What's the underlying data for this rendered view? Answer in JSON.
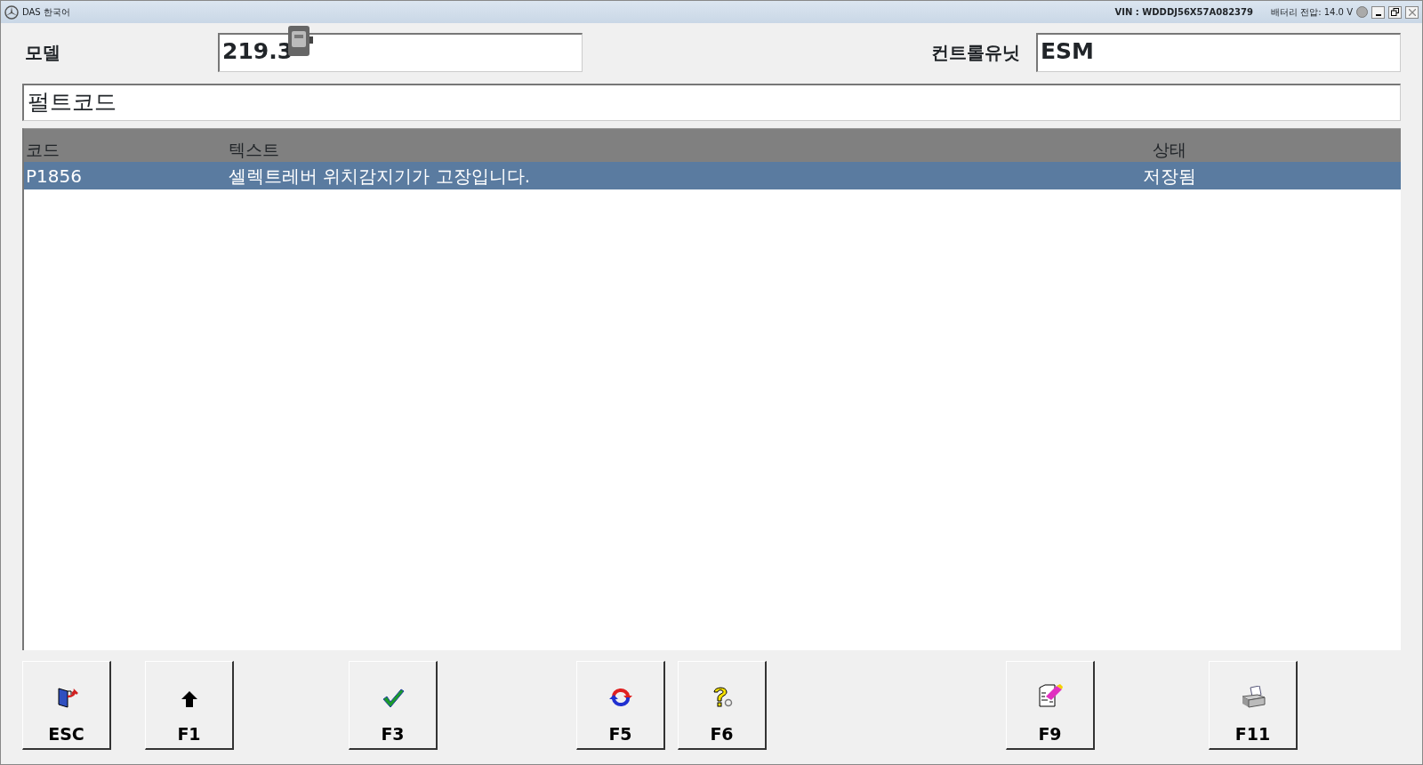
{
  "window": {
    "title": "DAS 한국어",
    "vin": "VIN : WDDDJ56X57A082379",
    "battery": "배터리 전압: 14.0 V"
  },
  "model": {
    "label": "모델",
    "value": "219.3"
  },
  "control_unit": {
    "label": "컨트롤유닛",
    "value": "ESM"
  },
  "section_title": "펄트코드",
  "table": {
    "columns": [
      "코드",
      "텍스트",
      "상태"
    ],
    "rows": [
      {
        "code": "P1856",
        "text": "셀렉트레버 위치감지기가 고장입니다.",
        "status": "저장됨",
        "selected": true
      }
    ]
  },
  "buttons": [
    {
      "label": "ESC",
      "kind": "exit"
    },
    {
      "label": "F1",
      "kind": "up"
    },
    {
      "label": "F3",
      "kind": "check"
    },
    {
      "label": "F5",
      "kind": "refresh"
    },
    {
      "label": "F6",
      "kind": "help"
    },
    {
      "label": "F9",
      "kind": "erase"
    },
    {
      "label": "F11",
      "kind": "print"
    }
  ]
}
